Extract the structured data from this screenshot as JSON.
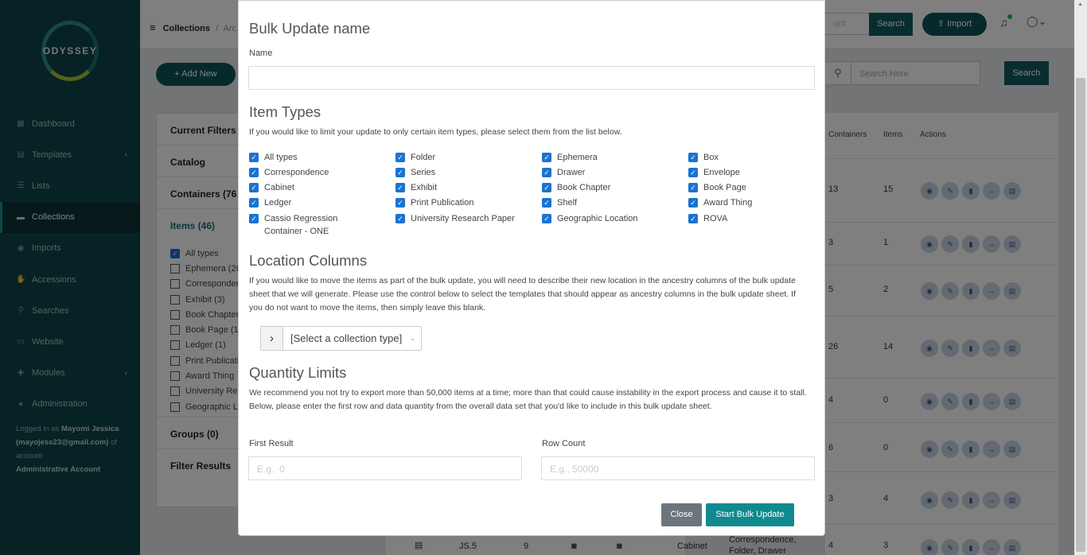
{
  "app": {
    "logo_text": "ODYSSEY"
  },
  "sidebar": {
    "items": [
      {
        "label": "Dashboard",
        "icon": "dashboard-icon"
      },
      {
        "label": "Templates",
        "icon": "file-icon"
      },
      {
        "label": "Lists",
        "icon": "list-icon"
      },
      {
        "label": "Collections",
        "icon": "archive-icon"
      },
      {
        "label": "Imports",
        "icon": "database-icon"
      },
      {
        "label": "Accessions",
        "icon": "handshake-icon"
      },
      {
        "label": "Searches",
        "icon": "search-icon"
      },
      {
        "label": "Website",
        "icon": "laptop-icon"
      },
      {
        "label": "Modules",
        "icon": "puzzle-icon"
      },
      {
        "label": "Administration",
        "icon": "user-icon"
      }
    ],
    "logged_prefix": "Logged in as",
    "user_name": "Mayomi Jessica",
    "user_email": "(mayojess23@gmail.com)",
    "of_account": "of account",
    "account_name": "Administrative Account"
  },
  "header": {
    "breadcrumb_1": "Collections",
    "breadcrumb_2": "Arc",
    "top_search_placeholder": "unt",
    "top_search_button": "Search",
    "import_button": "Import"
  },
  "toolbar": {
    "add_new": "Add New",
    "search_placeholder": "Search Here",
    "search_button": "Search"
  },
  "filters": {
    "current_filters": "Current Filters",
    "catalog": "Catalog",
    "containers": "Containers (76",
    "items": "Items (46)",
    "item_options": [
      "All types",
      "Ephemera (26",
      "Correspondence",
      "Exhibit (3)",
      "Book Chapter",
      "Book Page (1",
      "Ledger (1)",
      "Print Publication",
      "Award Thing",
      "University Re",
      "Geographic Lo"
    ],
    "groups": "Groups (0)",
    "filter_results": "Filter Results"
  },
  "table": {
    "headers": [
      "Containers",
      "Items",
      "Actions"
    ],
    "rows": [
      {
        "containers": "13",
        "items": "15"
      },
      {
        "containers": "3",
        "items": "1"
      },
      {
        "containers": "5",
        "items": "2"
      },
      {
        "containers": "26",
        "items": "14"
      },
      {
        "containers": "4",
        "items": "0"
      },
      {
        "containers": "6",
        "items": "0"
      },
      {
        "containers": "3",
        "items": "4"
      }
    ],
    "last_row": {
      "code": "JS.5",
      "num": "9",
      "type": "Cabinet",
      "contains": "Correspondence, Folder, Drawer",
      "containers": "4",
      "items": "3"
    }
  },
  "modal": {
    "name_section": "Bulk Update name",
    "name_label": "Name",
    "item_types_title": "Item Types",
    "item_types_desc": "If you would like to limit your update to only certain item types, please select them from the list below.",
    "item_types": [
      [
        "All types",
        "Folder",
        "Ephemera",
        "Box"
      ],
      [
        "Correspondence",
        "Series",
        "Drawer",
        "Envelope"
      ],
      [
        "Cabinet",
        "Exhibit",
        "Book Chapter",
        "Book Page"
      ],
      [
        "Ledger",
        "Print Publication",
        "Shelf",
        "Award Thing"
      ],
      [
        "Cassio Regression Container - ONE",
        "University Research Paper",
        "Geographic Location",
        "ROVA"
      ]
    ],
    "location_title": "Location Columns",
    "location_desc": "If you would like to move the items as part of the bulk update, you will need to describe their new location in the ancestry columns of the bulk update sheet that we will generate. Please use the control below to select the templates that should appear as ancestry columns in the bulk update sheet. If you do not want to move the items, then simply leave this blank.",
    "collection_type_select": "[Select a collection type]",
    "quantity_title": "Quantity Limits",
    "quantity_desc": "We recommend you not try to export more than 50,000 items at a time; more than that could cause instability in the export process and cause it to stall. Below, please enter the first row and data quantity from the overall data set that you'd like to include in this bulk update sheet.",
    "first_result_label": "First Result",
    "first_result_placeholder": "E.g., 0",
    "row_count_label": "Row Count",
    "row_count_placeholder": "E.g., 50000",
    "close_button": "Close",
    "start_button": "Start Bulk Update"
  }
}
